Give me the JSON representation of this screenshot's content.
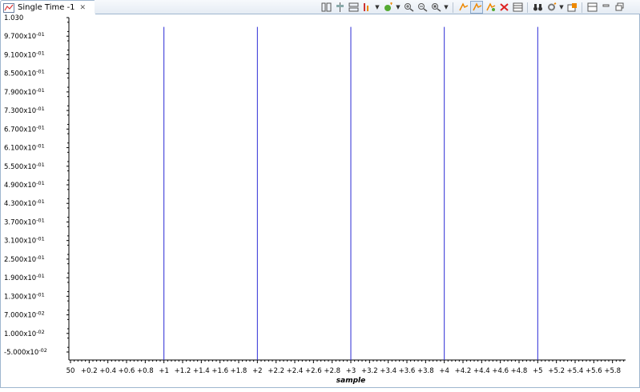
{
  "view": {
    "tab_title": "Single Time -1",
    "tab_close_icon": "close-icon"
  },
  "toolbar": {
    "buttons": [
      "columns-icon",
      "align-icon",
      "rows-icon",
      "chart-marker-icon",
      "dropdown",
      "add-node-icon",
      "dropdown",
      "zoom-in-icon",
      "zoom-out-icon",
      "zoom-fit-icon",
      "dropdown",
      "separator",
      "run-icon",
      "auto-refresh-icon",
      "sync-icon",
      "clear-icon",
      "table-icon",
      "separator",
      "binoculars-icon",
      "settings-icon",
      "dropdown",
      "export-icon",
      "separator",
      "layout-icon",
      "minimize-icon",
      "maximize-icon"
    ]
  },
  "chart_data": {
    "type": "bar",
    "xlabel": "sample",
    "ylabel": "",
    "x_tick_labels": [
      "50",
      "+0.2",
      "+0.4",
      "+0.6",
      "+0.8",
      "+1",
      "+1.2",
      "+1.4",
      "+1.6",
      "+1.8",
      "+2",
      "+2.2",
      "+2.4",
      "+2.6",
      "+2.8",
      "+3",
      "+3.2",
      "+3.4",
      "+3.6",
      "+3.8",
      "+4",
      "+4.2",
      "+4.4",
      "+4.6",
      "+4.8",
      "+5",
      "+5.2",
      "+5.4",
      "+5.6",
      "+5.8"
    ],
    "y_tick_labels": [
      {
        "text": "1.030",
        "exp": ""
      },
      {
        "text": "9.700x10",
        "exp": "-01"
      },
      {
        "text": "9.100x10",
        "exp": "-01"
      },
      {
        "text": "8.500x10",
        "exp": "-01"
      },
      {
        "text": "7.900x10",
        "exp": "-01"
      },
      {
        "text": "7.300x10",
        "exp": "-01"
      },
      {
        "text": "6.700x10",
        "exp": "-01"
      },
      {
        "text": "6.100x10",
        "exp": "-01"
      },
      {
        "text": "5.500x10",
        "exp": "-01"
      },
      {
        "text": "4.900x10",
        "exp": "-01"
      },
      {
        "text": "4.300x10",
        "exp": "-01"
      },
      {
        "text": "3.700x10",
        "exp": "-01"
      },
      {
        "text": "3.100x10",
        "exp": "-01"
      },
      {
        "text": "2.500x10",
        "exp": "-01"
      },
      {
        "text": "1.900x10",
        "exp": "-01"
      },
      {
        "text": "1.300x10",
        "exp": "-01"
      },
      {
        "text": "7.000x10",
        "exp": "-02"
      },
      {
        "text": "1.000x10",
        "exp": "-02"
      },
      {
        "text": "-5.000x10",
        "exp": "-02"
      }
    ],
    "x_range": [
      0,
      6.0
    ],
    "y_range": [
      -0.05,
      1.03
    ],
    "impulses": [
      {
        "x": 1,
        "y": 1.0
      },
      {
        "x": 2,
        "y": 1.0
      },
      {
        "x": 3,
        "y": 1.0
      },
      {
        "x": 4,
        "y": 1.0
      },
      {
        "x": 5,
        "y": 1.0
      }
    ],
    "line_color": "#2b2bd6",
    "grid": false
  }
}
